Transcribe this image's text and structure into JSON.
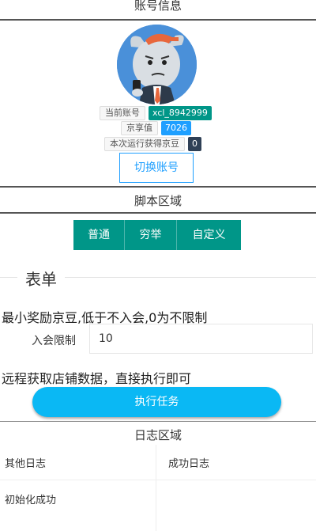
{
  "account_section": {
    "title": "账号信息",
    "current_account_label": "当前账号",
    "current_account_value": "xcl_8942999",
    "jx_value_label": "京享值",
    "jx_value": "7026",
    "beans_label": "本次运行获得京豆",
    "beans_value": "0",
    "switch_button_label": "切换账号"
  },
  "script_section": {
    "title": "脚本区域",
    "tabs": [
      "普通",
      "穷举",
      "自定义"
    ]
  },
  "form_section": {
    "legend": "表单",
    "min_reward_desc": "最小奖励京豆,低于不入会,0为不限制",
    "join_limit_label": "入会限制",
    "join_limit_value": "10",
    "remote_desc": "远程获取店铺数据，直接执行即可",
    "run_button_label": "执行任务"
  },
  "log_section": {
    "title": "日志区域",
    "other_log_header": "其他日志",
    "success_log_header": "成功日志",
    "other_log_entries": [
      "初始化成功"
    ]
  },
  "colors": {
    "teal": "#009688",
    "blue": "#1e9fff",
    "cyan": "#0ab8f4",
    "dark_badge": "#2f4056"
  }
}
